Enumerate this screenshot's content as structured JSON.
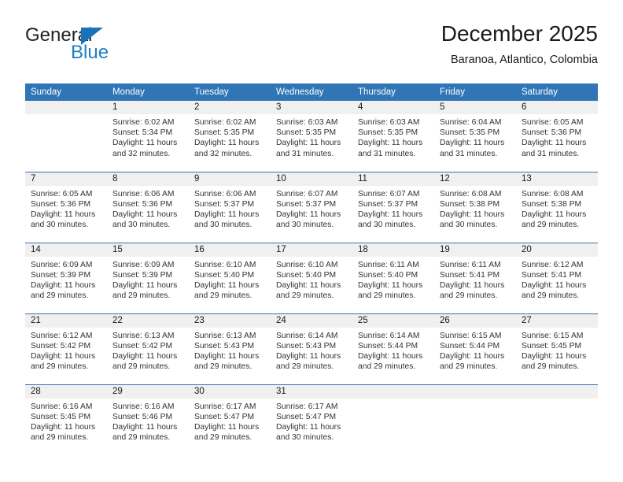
{
  "brand": {
    "name_part1": "General",
    "name_part2": "Blue"
  },
  "header": {
    "title": "December 2025",
    "subtitle": "Baranoa, Atlantico, Colombia"
  },
  "theme": {
    "header_blue": "#3075b5",
    "logo_blue": "#1f7fc4",
    "daynum_band": "#f0f0f0",
    "text": "#333333"
  },
  "weekday_headers": [
    "Sunday",
    "Monday",
    "Tuesday",
    "Wednesday",
    "Thursday",
    "Friday",
    "Saturday"
  ],
  "labels": {
    "sunrise_prefix": "Sunrise:",
    "sunset_prefix": "Sunset:",
    "daylight_prefix": "Daylight:"
  },
  "weeks": [
    [
      {
        "day": "",
        "sunrise": "",
        "sunset": "",
        "daylight_line1": "",
        "daylight_line2": ""
      },
      {
        "day": "1",
        "sunrise": "Sunrise: 6:02 AM",
        "sunset": "Sunset: 5:34 PM",
        "daylight_line1": "Daylight: 11 hours",
        "daylight_line2": "and 32 minutes."
      },
      {
        "day": "2",
        "sunrise": "Sunrise: 6:02 AM",
        "sunset": "Sunset: 5:35 PM",
        "daylight_line1": "Daylight: 11 hours",
        "daylight_line2": "and 32 minutes."
      },
      {
        "day": "3",
        "sunrise": "Sunrise: 6:03 AM",
        "sunset": "Sunset: 5:35 PM",
        "daylight_line1": "Daylight: 11 hours",
        "daylight_line2": "and 31 minutes."
      },
      {
        "day": "4",
        "sunrise": "Sunrise: 6:03 AM",
        "sunset": "Sunset: 5:35 PM",
        "daylight_line1": "Daylight: 11 hours",
        "daylight_line2": "and 31 minutes."
      },
      {
        "day": "5",
        "sunrise": "Sunrise: 6:04 AM",
        "sunset": "Sunset: 5:35 PM",
        "daylight_line1": "Daylight: 11 hours",
        "daylight_line2": "and 31 minutes."
      },
      {
        "day": "6",
        "sunrise": "Sunrise: 6:05 AM",
        "sunset": "Sunset: 5:36 PM",
        "daylight_line1": "Daylight: 11 hours",
        "daylight_line2": "and 31 minutes."
      }
    ],
    [
      {
        "day": "7",
        "sunrise": "Sunrise: 6:05 AM",
        "sunset": "Sunset: 5:36 PM",
        "daylight_line1": "Daylight: 11 hours",
        "daylight_line2": "and 30 minutes."
      },
      {
        "day": "8",
        "sunrise": "Sunrise: 6:06 AM",
        "sunset": "Sunset: 5:36 PM",
        "daylight_line1": "Daylight: 11 hours",
        "daylight_line2": "and 30 minutes."
      },
      {
        "day": "9",
        "sunrise": "Sunrise: 6:06 AM",
        "sunset": "Sunset: 5:37 PM",
        "daylight_line1": "Daylight: 11 hours",
        "daylight_line2": "and 30 minutes."
      },
      {
        "day": "10",
        "sunrise": "Sunrise: 6:07 AM",
        "sunset": "Sunset: 5:37 PM",
        "daylight_line1": "Daylight: 11 hours",
        "daylight_line2": "and 30 minutes."
      },
      {
        "day": "11",
        "sunrise": "Sunrise: 6:07 AM",
        "sunset": "Sunset: 5:37 PM",
        "daylight_line1": "Daylight: 11 hours",
        "daylight_line2": "and 30 minutes."
      },
      {
        "day": "12",
        "sunrise": "Sunrise: 6:08 AM",
        "sunset": "Sunset: 5:38 PM",
        "daylight_line1": "Daylight: 11 hours",
        "daylight_line2": "and 30 minutes."
      },
      {
        "day": "13",
        "sunrise": "Sunrise: 6:08 AM",
        "sunset": "Sunset: 5:38 PM",
        "daylight_line1": "Daylight: 11 hours",
        "daylight_line2": "and 29 minutes."
      }
    ],
    [
      {
        "day": "14",
        "sunrise": "Sunrise: 6:09 AM",
        "sunset": "Sunset: 5:39 PM",
        "daylight_line1": "Daylight: 11 hours",
        "daylight_line2": "and 29 minutes."
      },
      {
        "day": "15",
        "sunrise": "Sunrise: 6:09 AM",
        "sunset": "Sunset: 5:39 PM",
        "daylight_line1": "Daylight: 11 hours",
        "daylight_line2": "and 29 minutes."
      },
      {
        "day": "16",
        "sunrise": "Sunrise: 6:10 AM",
        "sunset": "Sunset: 5:40 PM",
        "daylight_line1": "Daylight: 11 hours",
        "daylight_line2": "and 29 minutes."
      },
      {
        "day": "17",
        "sunrise": "Sunrise: 6:10 AM",
        "sunset": "Sunset: 5:40 PM",
        "daylight_line1": "Daylight: 11 hours",
        "daylight_line2": "and 29 minutes."
      },
      {
        "day": "18",
        "sunrise": "Sunrise: 6:11 AM",
        "sunset": "Sunset: 5:40 PM",
        "daylight_line1": "Daylight: 11 hours",
        "daylight_line2": "and 29 minutes."
      },
      {
        "day": "19",
        "sunrise": "Sunrise: 6:11 AM",
        "sunset": "Sunset: 5:41 PM",
        "daylight_line1": "Daylight: 11 hours",
        "daylight_line2": "and 29 minutes."
      },
      {
        "day": "20",
        "sunrise": "Sunrise: 6:12 AM",
        "sunset": "Sunset: 5:41 PM",
        "daylight_line1": "Daylight: 11 hours",
        "daylight_line2": "and 29 minutes."
      }
    ],
    [
      {
        "day": "21",
        "sunrise": "Sunrise: 6:12 AM",
        "sunset": "Sunset: 5:42 PM",
        "daylight_line1": "Daylight: 11 hours",
        "daylight_line2": "and 29 minutes."
      },
      {
        "day": "22",
        "sunrise": "Sunrise: 6:13 AM",
        "sunset": "Sunset: 5:42 PM",
        "daylight_line1": "Daylight: 11 hours",
        "daylight_line2": "and 29 minutes."
      },
      {
        "day": "23",
        "sunrise": "Sunrise: 6:13 AM",
        "sunset": "Sunset: 5:43 PM",
        "daylight_line1": "Daylight: 11 hours",
        "daylight_line2": "and 29 minutes."
      },
      {
        "day": "24",
        "sunrise": "Sunrise: 6:14 AM",
        "sunset": "Sunset: 5:43 PM",
        "daylight_line1": "Daylight: 11 hours",
        "daylight_line2": "and 29 minutes."
      },
      {
        "day": "25",
        "sunrise": "Sunrise: 6:14 AM",
        "sunset": "Sunset: 5:44 PM",
        "daylight_line1": "Daylight: 11 hours",
        "daylight_line2": "and 29 minutes."
      },
      {
        "day": "26",
        "sunrise": "Sunrise: 6:15 AM",
        "sunset": "Sunset: 5:44 PM",
        "daylight_line1": "Daylight: 11 hours",
        "daylight_line2": "and 29 minutes."
      },
      {
        "day": "27",
        "sunrise": "Sunrise: 6:15 AM",
        "sunset": "Sunset: 5:45 PM",
        "daylight_line1": "Daylight: 11 hours",
        "daylight_line2": "and 29 minutes."
      }
    ],
    [
      {
        "day": "28",
        "sunrise": "Sunrise: 6:16 AM",
        "sunset": "Sunset: 5:45 PM",
        "daylight_line1": "Daylight: 11 hours",
        "daylight_line2": "and 29 minutes."
      },
      {
        "day": "29",
        "sunrise": "Sunrise: 6:16 AM",
        "sunset": "Sunset: 5:46 PM",
        "daylight_line1": "Daylight: 11 hours",
        "daylight_line2": "and 29 minutes."
      },
      {
        "day": "30",
        "sunrise": "Sunrise: 6:17 AM",
        "sunset": "Sunset: 5:47 PM",
        "daylight_line1": "Daylight: 11 hours",
        "daylight_line2": "and 29 minutes."
      },
      {
        "day": "31",
        "sunrise": "Sunrise: 6:17 AM",
        "sunset": "Sunset: 5:47 PM",
        "daylight_line1": "Daylight: 11 hours",
        "daylight_line2": "and 30 minutes."
      },
      {
        "day": "",
        "sunrise": "",
        "sunset": "",
        "daylight_line1": "",
        "daylight_line2": ""
      },
      {
        "day": "",
        "sunrise": "",
        "sunset": "",
        "daylight_line1": "",
        "daylight_line2": ""
      },
      {
        "day": "",
        "sunrise": "",
        "sunset": "",
        "daylight_line1": "",
        "daylight_line2": ""
      }
    ]
  ]
}
